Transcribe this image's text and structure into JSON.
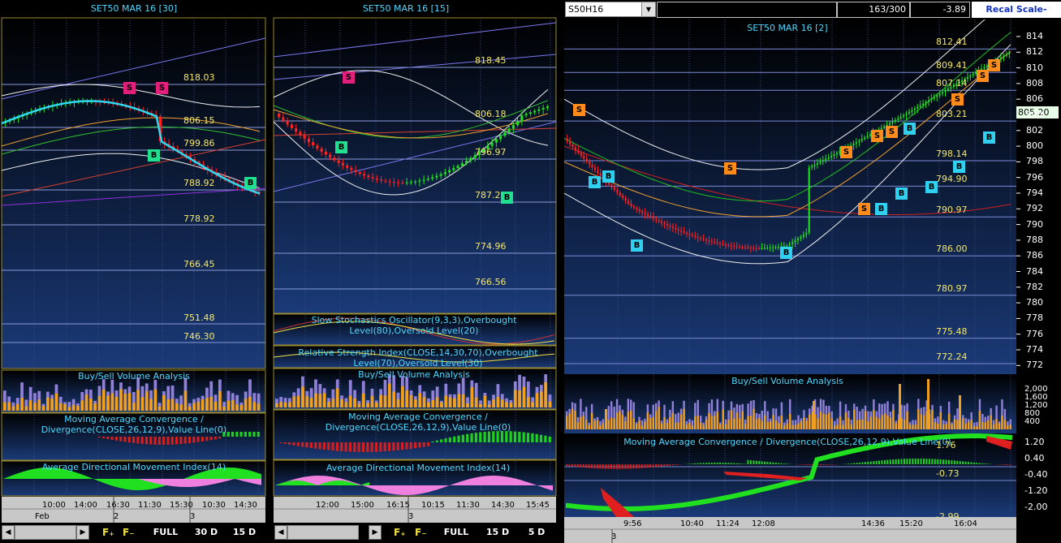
{
  "panel1": {
    "title": "SET50 MAR 16  [30]",
    "levels": [
      "818.03",
      "806.15",
      "799.86",
      "788.92",
      "778.92",
      "766.45",
      "751.48",
      "746.30"
    ],
    "signals": [
      "S",
      "S",
      "B",
      "B"
    ],
    "volume_title": "Buy/Sell Volume Analysis",
    "macd_title": "Moving Average Convergence /\nDivergence(CLOSE,26,12,9),Value Line(0)",
    "adx_title": "Average Directional Movement Index(14)",
    "xlabels": [
      "10:00",
      "14:00",
      "16:30",
      "11:30",
      "15:30",
      "10:30",
      "14:30"
    ],
    "date_labels": [
      "Feb",
      "2",
      "3"
    ],
    "toolbar": [
      "FULL",
      "30 D",
      "15 D"
    ]
  },
  "panel2": {
    "title": "SET50 MAR 16  [15]",
    "levels": [
      "818.45",
      "806.18",
      "796.97",
      "787.2",
      "774.96",
      "766.56"
    ],
    "signals": [
      "S",
      "B",
      "B"
    ],
    "stoch_title": "Slow Stochastics Oscillator(9,3,3),Overbought\nLevel(80),Oversold Level(20)",
    "rsi_title": "Relative Strength Index(CLOSE,14,30,70),Overbought\nLevel(70),Oversold Level(30)",
    "volume_title": "Buy/Sell Volume Analysis",
    "macd_title": "Moving Average Convergence /\nDivergence(CLOSE,26,12,9),Value Line(0)",
    "adx_title": "Average Directional Movement Index(14)",
    "xlabels": [
      "12:00",
      "15:00",
      "16:15",
      "10:15",
      "11:30",
      "14:30",
      "15:45"
    ],
    "date_labels": [
      "3"
    ],
    "toolbar": [
      "FULL",
      "15 D",
      "5 D"
    ]
  },
  "panel3": {
    "symbol": "S50H16",
    "counter": "163/300",
    "change": "-3.89",
    "recal": "Recal Scale-Linear",
    "title": "SET50 MAR 16  [2]",
    "last_price": "805.20",
    "levels": [
      "812.41",
      "809.41",
      "807.14",
      "803.21",
      "798.14",
      "794.90",
      "790.97",
      "786.00",
      "780.97",
      "775.48",
      "772.24"
    ],
    "yticks": [
      "814",
      "812",
      "810",
      "808",
      "806",
      "804",
      "802",
      "800",
      "798",
      "796",
      "794",
      "792",
      "790",
      "788",
      "786",
      "784",
      "782",
      "780",
      "778",
      "776",
      "774",
      "772"
    ],
    "volume_title": "Buy/Sell Volume Analysis",
    "volume_ticks": [
      "2,000",
      "1,600",
      "1,200",
      "800",
      "400"
    ],
    "macd_title": "Moving Average Convergence / Divergence(CLOSE,26,12,9),Value Line(0)",
    "macd_ticks": [
      "1.20",
      "0.40",
      "-0.40",
      "-1.20",
      "-2.00"
    ],
    "macd_labels": [
      "1.76",
      "-0.73",
      "-2.99"
    ],
    "xlabels": [
      "9:56",
      "10:40",
      "11:24",
      "12:08",
      "14:36",
      "15:20",
      "16:04"
    ],
    "date_labels": [
      "3"
    ],
    "signals": [
      "S",
      "B",
      "B",
      "B",
      "S",
      "B",
      "S",
      "S",
      "S",
      "S",
      "B",
      "B",
      "B",
      "B",
      "S",
      "B",
      "S",
      "S",
      "B"
    ]
  },
  "colors": {
    "price_up": "#20e020",
    "price_down": "#ff2020",
    "sell_signal": "#ff8c1a",
    "buy_signal": "#30d0f0",
    "bg_gradient_top": "#000000",
    "bg_gradient_bottom": "#1a3a78"
  }
}
